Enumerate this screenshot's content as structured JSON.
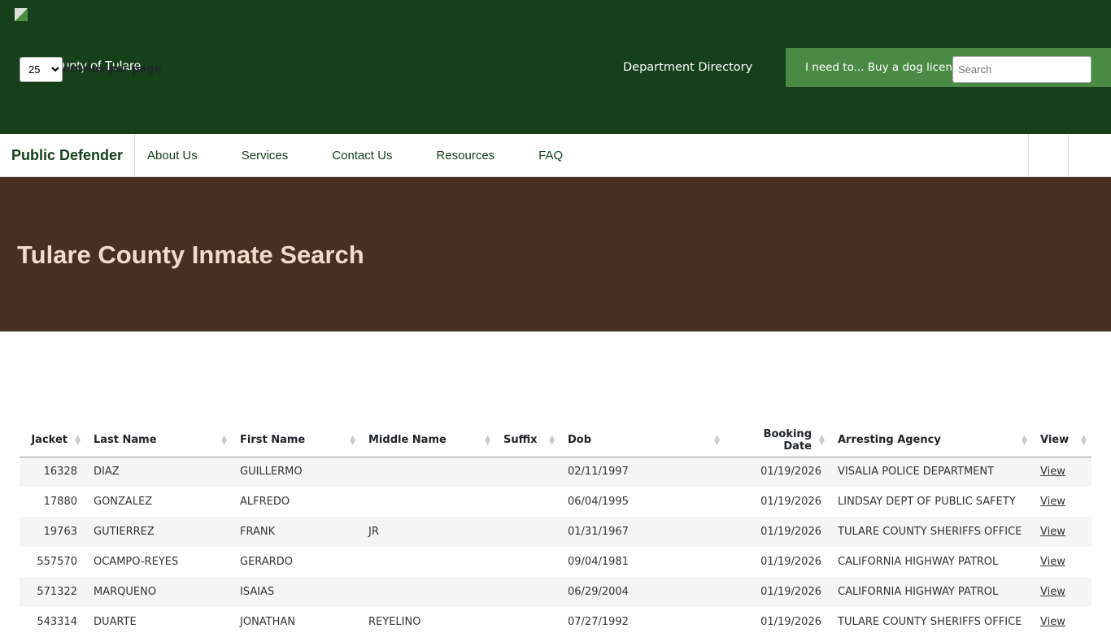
{
  "header": {
    "site_name": "County of Tulare",
    "department_directory": "Department Directory",
    "i_need_to": "I need to... Buy a dog license"
  },
  "nav": {
    "brand": "Public Defender",
    "items": [
      "About Us",
      "Services",
      "Contact Us",
      "Resources",
      "FAQ"
    ]
  },
  "hero": {
    "title": "Tulare County Inmate Search"
  },
  "controls": {
    "page_size": "25",
    "entries_label": "entries per page",
    "search_placeholder": "Search"
  },
  "table": {
    "columns": [
      "Jacket",
      "Last Name",
      "First Name",
      "Middle Name",
      "Suffix",
      "Dob",
      "Booking Date",
      "Arresting Agency",
      "View"
    ],
    "rows": [
      [
        "16328",
        "DIAZ",
        "GUILLERMO",
        "",
        "",
        "02/11/1997",
        "01/19/2026",
        "VISALIA POLICE DEPARTMENT",
        "View"
      ],
      [
        "17880",
        "GONZALEZ",
        "ALFREDO",
        "",
        "",
        "06/04/1995",
        "01/19/2026",
        "LINDSAY DEPT OF PUBLIC SAFETY",
        "View"
      ],
      [
        "19763",
        "GUTIERREZ",
        "FRANK",
        "JR",
        "",
        "01/31/1967",
        "01/19/2026",
        "TULARE COUNTY SHERIFFS OFFICE",
        "View"
      ],
      [
        "557570",
        "OCAMPO-REYES",
        "GERARDO",
        "",
        "",
        "09/04/1981",
        "01/19/2026",
        "CALIFORNIA HIGHWAY PATROL",
        "View"
      ],
      [
        "571322",
        "MARQUENO",
        "ISAIAS",
        "",
        "",
        "06/29/2004",
        "01/19/2026",
        "CALIFORNIA HIGHWAY PATROL",
        "View"
      ],
      [
        "543314",
        "DUARTE",
        "JONATHAN",
        "REYELINO",
        "",
        "07/27/1992",
        "01/19/2026",
        "TULARE COUNTY SHERIFFS OFFICE",
        "View"
      ]
    ]
  }
}
